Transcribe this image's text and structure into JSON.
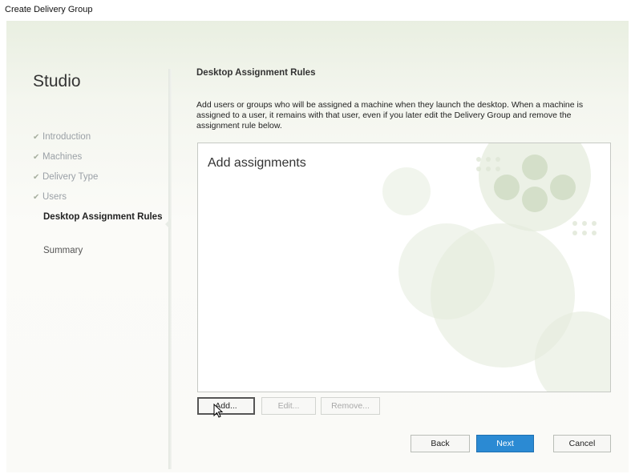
{
  "window": {
    "title": "Create Delivery Group"
  },
  "sidebar": {
    "app_name": "Studio",
    "steps": [
      {
        "label": "Introduction",
        "state": "done"
      },
      {
        "label": "Machines",
        "state": "done"
      },
      {
        "label": "Delivery Type",
        "state": "done"
      },
      {
        "label": "Users",
        "state": "done"
      },
      {
        "label": "Desktop Assignment Rules",
        "state": "current"
      },
      {
        "label": "Summary",
        "state": "pending"
      }
    ]
  },
  "main": {
    "heading": "Desktop Assignment Rules",
    "description": "Add users or groups who will be assigned a machine when they launch the desktop. When a machine is assigned to a user, it remains with that user, even if you later edit the Delivery Group and remove the assignment rule below.",
    "list_placeholder": "Add assignments",
    "list_buttons": {
      "add": "Add...",
      "edit": "Edit...",
      "remove": "Remove..."
    }
  },
  "footer": {
    "back": "Back",
    "next": "Next",
    "cancel": "Cancel"
  },
  "colors": {
    "primary_button": "#2b8ad3",
    "accent_watermark": "#cfdcc3"
  },
  "icons": {
    "check": "check-icon",
    "cursor": "mouse-pointer-icon"
  }
}
